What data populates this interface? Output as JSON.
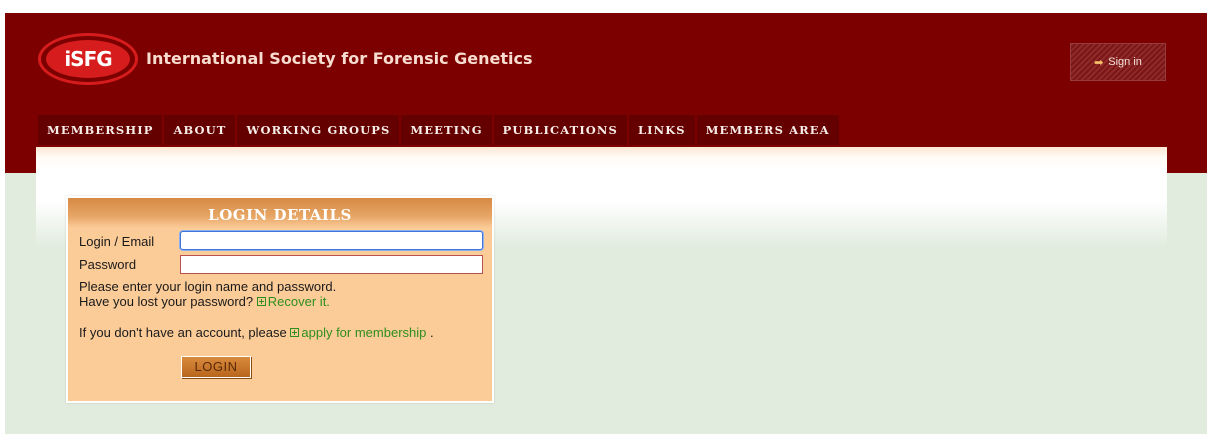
{
  "header": {
    "logo_text": "iSFG",
    "site_title": "International Society for Forensic Genetics",
    "sign_in_label": "Sign in"
  },
  "nav": {
    "items": [
      {
        "label": "MEMBERSHIP"
      },
      {
        "label": "ABOUT"
      },
      {
        "label": "WORKING GROUPS"
      },
      {
        "label": "MEETING"
      },
      {
        "label": "PUBLICATIONS"
      },
      {
        "label": "LINKS"
      },
      {
        "label": "MEMBERS AREA"
      }
    ]
  },
  "login": {
    "title": "LOGIN DETAILS",
    "email_label": "Login / Email",
    "email_value": "",
    "password_label": "Password",
    "password_value": "",
    "instructions": "Please enter your login name and password.",
    "lost_password_text": "Have you lost your password?",
    "recover_link": "Recover it.",
    "no_account_text": "If you don't have an account, please",
    "apply_link": "apply for membership",
    "apply_suffix": ".",
    "button_label": "LOGIN"
  },
  "colors": {
    "header_bg": "#7c0000",
    "nav_bg": "#640000",
    "page_bg": "#e1ecde",
    "login_bg": "#fbcb98",
    "link": "#2e8f1e"
  },
  "icons": {
    "sign_in": "arrow-right-icon",
    "links": "plus-box-icon"
  }
}
